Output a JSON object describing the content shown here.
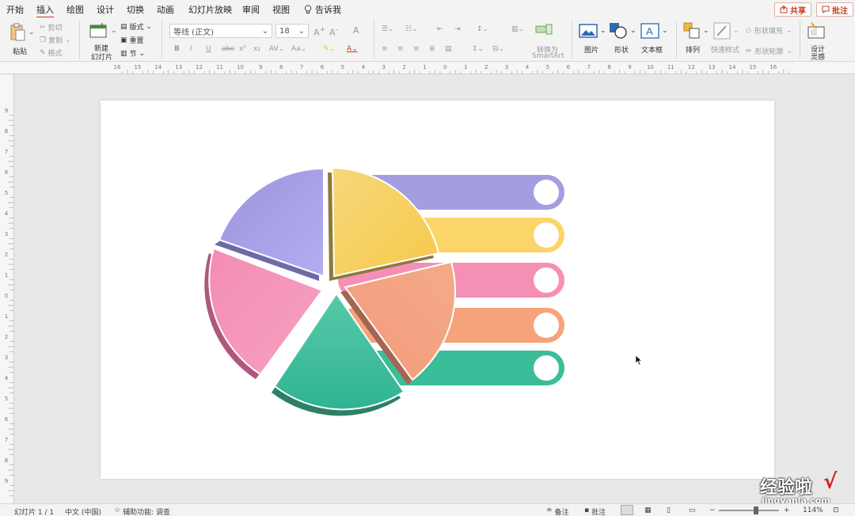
{
  "tabs": [
    "开始",
    "插入",
    "绘图",
    "设计",
    "切换",
    "动画",
    "幻灯片放映",
    "审阅",
    "视图"
  ],
  "active_tab": "插入",
  "tell_me": "告诉我",
  "share_label": "共享",
  "comments_label": "批注",
  "clipboard": {
    "paste": "粘贴",
    "cut": "剪切",
    "copy": "复制",
    "format": "格式"
  },
  "slides": {
    "new_slide_line1": "新建",
    "new_slide_line2": "幻灯片",
    "layout": "版式",
    "reset": "重置",
    "section": "节"
  },
  "font": {
    "name": "等线 (正文)",
    "size": "18"
  },
  "paragraph": {
    "convert_smartart_line1": "转换为",
    "convert_smartart_line2": "SmartArt"
  },
  "insert": {
    "picture": "图片",
    "shape": "形状",
    "textbox": "文本框"
  },
  "arrange": {
    "arrange": "排列",
    "quick_styles": "快速样式",
    "shape_fill": "形状填充",
    "shape_outline": "形状轮廓"
  },
  "designer": {
    "line1": "设计",
    "line2": "灵感"
  },
  "ruler": {
    "h_labels": [
      "16",
      "15",
      "14",
      "13",
      "12",
      "11",
      "10",
      "9",
      "8",
      "7",
      "6",
      "5",
      "4",
      "3",
      "2",
      "1",
      "0",
      "1",
      "2",
      "3",
      "4",
      "5",
      "6",
      "7",
      "8",
      "9",
      "10",
      "11",
      "12",
      "13",
      "14",
      "15",
      "16"
    ],
    "v_labels": [
      "9",
      "8",
      "7",
      "6",
      "5",
      "4",
      "3",
      "2",
      "1",
      "0",
      "1",
      "2",
      "3",
      "4",
      "5",
      "6",
      "7",
      "8",
      "9"
    ]
  },
  "status": {
    "slide_counter": "幻灯片 1 / 1",
    "language": "中文 (中国)",
    "accessibility": "辅助功能: 调查",
    "notes": "备注",
    "comments": "批注",
    "zoom": "114%"
  },
  "watermark": {
    "text": "经验啦",
    "check": "√",
    "url": "jingyanla.com"
  },
  "colors": {
    "accent": "#c43e1c",
    "purple": "#a49ee0",
    "yellow": "#fbd56a",
    "pink": "#f58fb6",
    "orange": "#f6a27a",
    "green": "#3bbd9a"
  }
}
